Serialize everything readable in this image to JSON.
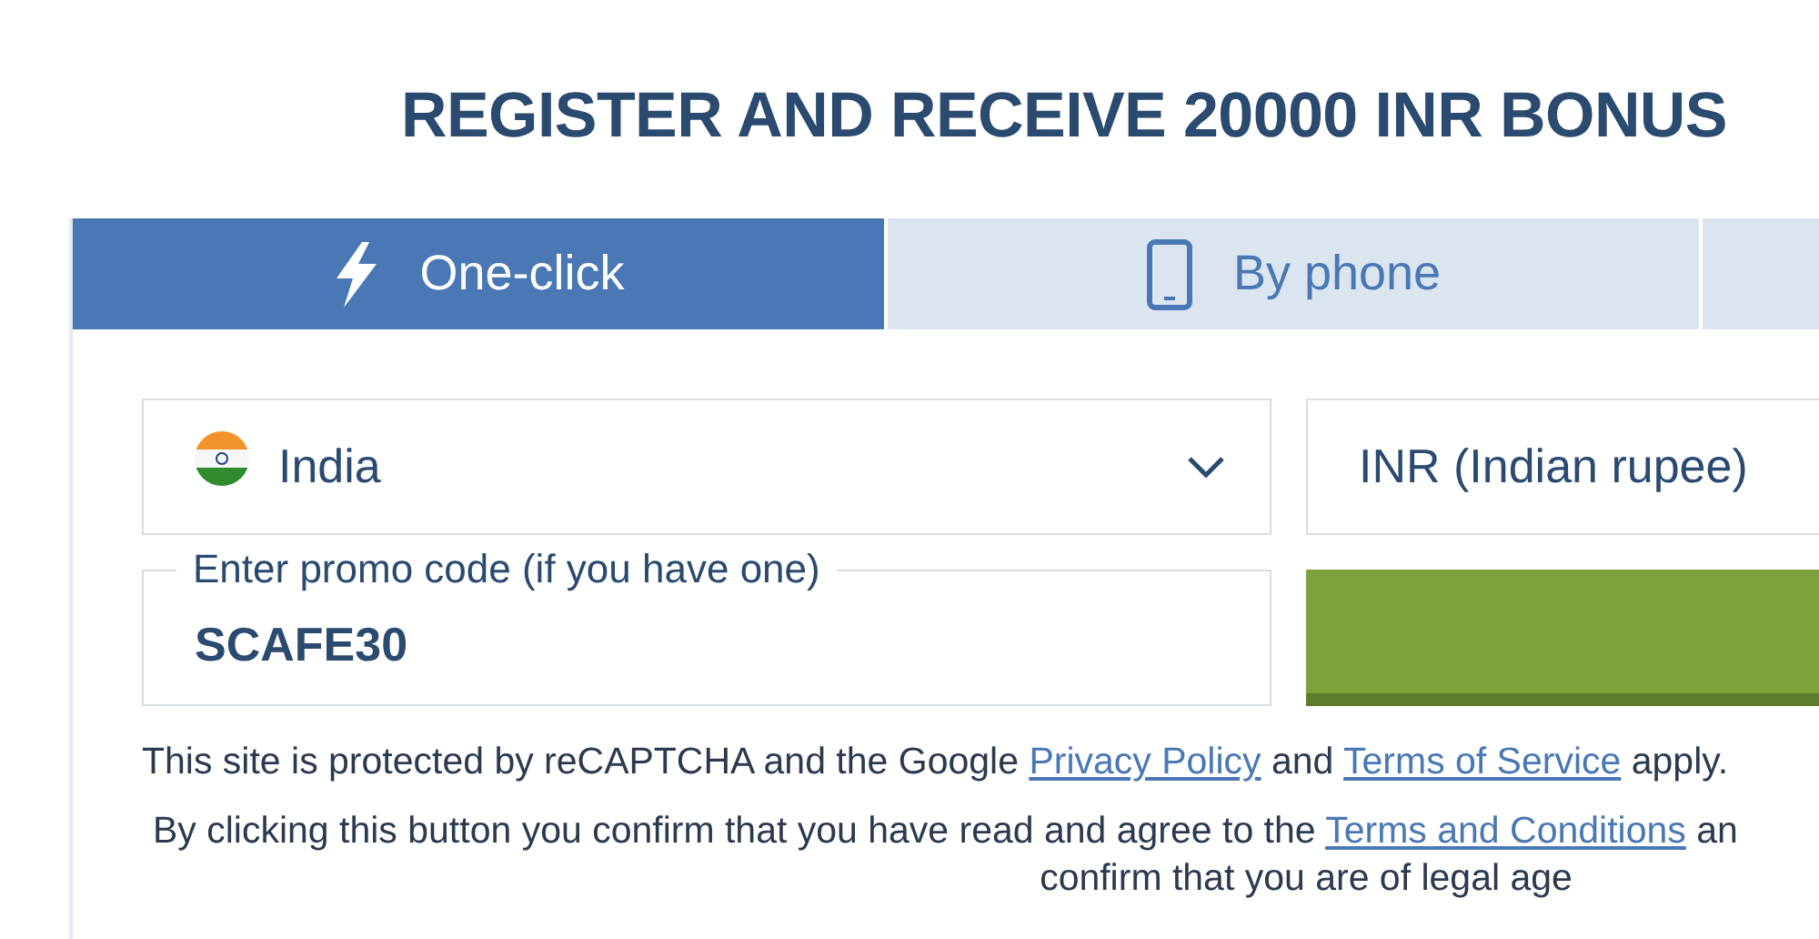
{
  "title": "REGISTER AND RECEIVE 20000 INR BONUS",
  "tabs": [
    {
      "label": "One-click",
      "kind": "bolt",
      "selected": true
    },
    {
      "label": "By phone",
      "kind": "phone",
      "selected": false
    },
    {
      "kind": "blank",
      "selected": false
    }
  ],
  "country": {
    "value": "India"
  },
  "currency": {
    "value": "INR (Indian rupee)"
  },
  "promo": {
    "placeholder": "Enter promo code (if you have one)",
    "value": "SCAFE30"
  },
  "recaptcha": {
    "before": "This site is protected by reCAPTCHA and the Google ",
    "link1": "Privacy Policy",
    "middle": " and ",
    "link2": "Terms of Service",
    "after": " apply."
  },
  "terms": {
    "before": "By clicking this button you confirm that you have read and agree to the ",
    "link": "Terms and Conditions",
    "after": " an",
    "line2": "confirm that you are of legal age"
  }
}
